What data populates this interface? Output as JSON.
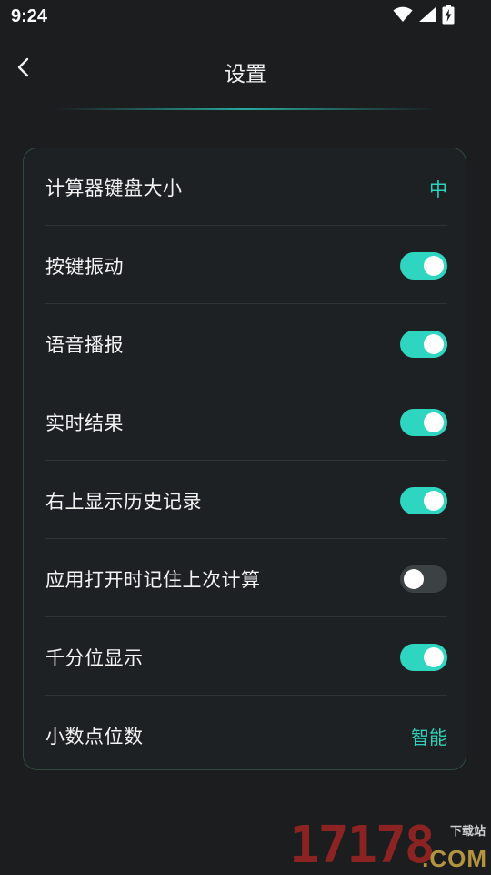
{
  "status_bar": {
    "time": "9:24",
    "icons": [
      "wifi-icon",
      "cell-signal-icon",
      "battery-charging-icon"
    ]
  },
  "app_bar": {
    "back_icon": "chevron-left-icon",
    "title": "设置"
  },
  "colors": {
    "accent": "#2ed6c1",
    "background": "#1b1d1f",
    "card_border": "#2f4a3a",
    "toggle_off": "#3c4244"
  },
  "settings": {
    "items": [
      {
        "label": "计算器键盘大小",
        "type": "value",
        "value": "中"
      },
      {
        "label": "按键振动",
        "type": "toggle",
        "on": true
      },
      {
        "label": "语音播报",
        "type": "toggle",
        "on": true
      },
      {
        "label": "实时结果",
        "type": "toggle",
        "on": true
      },
      {
        "label": "右上显示历史记录",
        "type": "toggle",
        "on": true
      },
      {
        "label": "应用打开时记住上次计算",
        "type": "toggle",
        "on": false
      },
      {
        "label": "千分位显示",
        "type": "toggle",
        "on": true
      },
      {
        "label": "小数点位数",
        "type": "value",
        "value": "智能"
      }
    ]
  },
  "watermark": {
    "number": "17178",
    "site": "下载站",
    "domain": ".COM"
  }
}
